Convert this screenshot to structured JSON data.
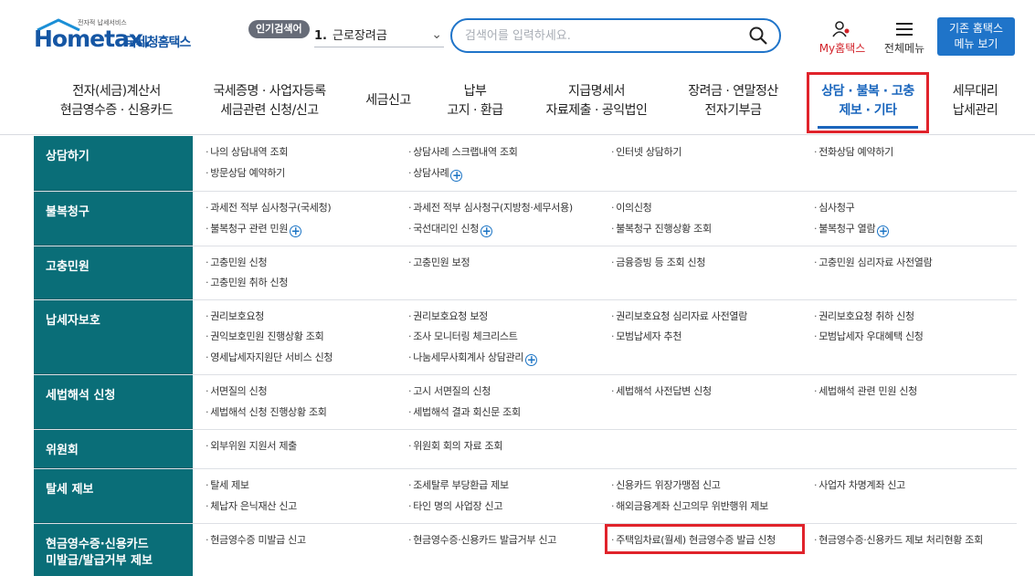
{
  "header": {
    "logo_tiny": "전자적 납세서비스",
    "logo_hometax": "Hometax.",
    "logo_korean": "국세청홈택스",
    "popular_tag": "인기검색어",
    "popular_num": "1.",
    "popular_value": "근로장려금",
    "search_placeholder": "검색어를 입력하세요.",
    "my_home": "My홈택스",
    "all_menu": "전체메뉴",
    "old_home_line1": "기존 홈택스",
    "old_home_line2": "메뉴 보기"
  },
  "gnb": [
    {
      "line1": "전자(세금)계산서",
      "line2": "현금영수증 · 신용카드"
    },
    {
      "line1": "국세증명 · 사업자등록",
      "line2": "세금관련 신청/신고"
    },
    {
      "line1": "세금신고",
      "line2": ""
    },
    {
      "line1": "납부",
      "line2": "고지 · 환급"
    },
    {
      "line1": "지급명세서",
      "line2": "자료제출 · 공익법인"
    },
    {
      "line1": "장려금 · 연말정산",
      "line2": "전자기부금"
    },
    {
      "line1": "상담 · 불복 · 고충",
      "line2": "제보 · 기타"
    },
    {
      "line1": "세무대리",
      "line2": "납세관리"
    }
  ],
  "sections": [
    {
      "title": "상담하기",
      "items": [
        "나의 상담내역 조회",
        "상담사례 스크랩내역 조회",
        "인터넷 상담하기",
        "전화상담 예약하기",
        "방문상담 예약하기",
        "상담사례"
      ]
    },
    {
      "title": "불복청구",
      "items": [
        "과세전 적부 심사청구(국세청)",
        "과세전 적부 심사청구(지방청·세무서용)",
        "이의신청",
        "심사청구",
        "불복청구 관련 민원",
        "국선대리인 신청",
        "불복청구 진행상황 조회",
        "불복청구 열람"
      ]
    },
    {
      "title": "고충민원",
      "items": [
        "고충민원 신청",
        "고충민원 보정",
        "금융증빙 등 조회 신청",
        "고충민원 심리자료 사전열람",
        "고충민원 취하 신청"
      ]
    },
    {
      "title": "납세자보호",
      "items": [
        "권리보호요청",
        "권리보호요청 보정",
        "권리보호요청 심리자료 사전열람",
        "권리보호요청 취하 신청",
        "권익보호민원 진행상황 조회",
        "조사 모니터링 체크리스트",
        "모범납세자 추천",
        "모범납세자 우대혜택 신청",
        "영세납세자지원단 서비스 신청",
        "나눔세무사회계사 상담관리"
      ]
    },
    {
      "title": "세법해석 신청",
      "items": [
        "서면질의 신청",
        "고시 서면질의 신청",
        "세법해석 사전답변 신청",
        "세법해석 관련 민원 신청",
        "세법해석 신청 진행상황 조회",
        "세법해석 결과 회신문 조회"
      ]
    },
    {
      "title": "위원회",
      "items": [
        "외부위원 지원서 제출",
        "위원회 회의 자료 조회"
      ]
    },
    {
      "title": "탈세 제보",
      "items": [
        "탈세 제보",
        "조세탈루 부당환급 제보",
        "신용카드 위장가맹점 신고",
        "사업자 차명계좌 신고",
        "체납자 은닉재산 신고",
        "타인 명의 사업장 신고",
        "해외금융계좌 신고의무 위반행위 제보"
      ]
    },
    {
      "title_line1": "현금영수증·신용카드",
      "title_line2": "미발급/발급거부 제보",
      "items": [
        "현금영수증 미발급 신고",
        "현금영수증·신용카드 발급거부 신고",
        "주택임차료(월세) 현금영수증 발급 신청",
        "현금영수증·신용카드 제보 처리현황 조회"
      ]
    }
  ],
  "colors": {
    "brand": "#1556a4",
    "accent": "#1f74c9",
    "row_title_bg": "#0a6e78",
    "highlight": "#e0232b"
  }
}
